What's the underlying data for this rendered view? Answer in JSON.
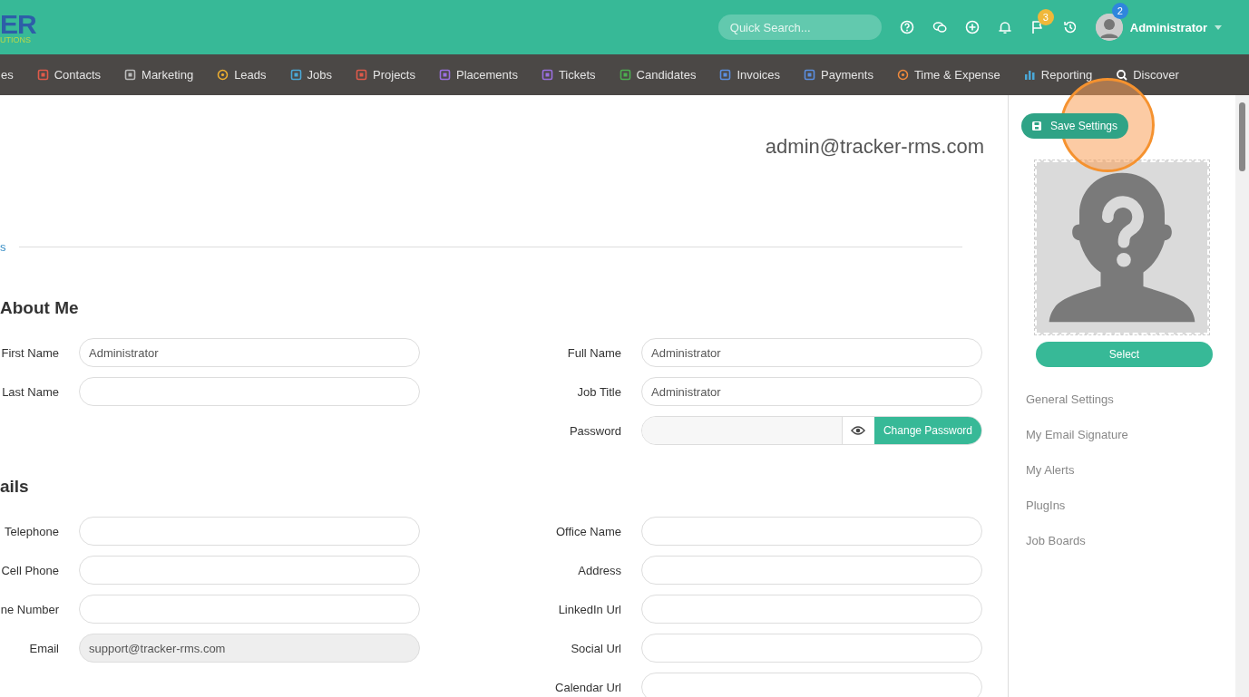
{
  "header": {
    "logo_text": "ER",
    "logo_subtext": "UTIONS",
    "search": {
      "placeholder": "Quick Search..."
    },
    "flag_badge": "3",
    "avatar_badge": "2",
    "user_name": "Administrator"
  },
  "nav": {
    "items": [
      {
        "label": "es"
      },
      {
        "label": "Contacts"
      },
      {
        "label": "Marketing"
      },
      {
        "label": "Leads"
      },
      {
        "label": "Jobs"
      },
      {
        "label": "Projects"
      },
      {
        "label": "Placements"
      },
      {
        "label": "Tickets"
      },
      {
        "label": "Candidates"
      },
      {
        "label": "Invoices"
      },
      {
        "label": "Payments"
      },
      {
        "label": "Time & Expense"
      },
      {
        "label": "Reporting"
      },
      {
        "label": "Discover"
      }
    ]
  },
  "main": {
    "account_email": "admin@tracker-rms.com",
    "tab_link": "s",
    "sections": [
      {
        "title": "About Me",
        "rows": [
          {
            "left": {
              "label": "First Name",
              "value": "Administrator"
            },
            "right": {
              "label": "Full Name",
              "value": "Administrator",
              "kind": "text"
            }
          },
          {
            "left": {
              "label": "Last Name"
            },
            "right": {
              "label": "Job Title",
              "value": "Administrator",
              "kind": "text"
            }
          },
          {
            "right": {
              "label": "Password",
              "kind": "password",
              "button": "Change Password"
            }
          }
        ]
      },
      {
        "title": "ails",
        "rows": [
          {
            "left": {
              "label": "Telephone"
            },
            "right": {
              "label": "Office Name",
              "kind": "text"
            }
          },
          {
            "left": {
              "label": "Cell Phone"
            },
            "right": {
              "label": "Address",
              "kind": "text"
            }
          },
          {
            "left": {
              "label": "ne Number"
            },
            "right": {
              "label": "LinkedIn Url",
              "kind": "text"
            }
          },
          {
            "left": {
              "label": "Email",
              "value": "support@tracker-rms.com",
              "readonly": true
            },
            "right": {
              "label": "Social Url",
              "kind": "text"
            }
          },
          {
            "right": {
              "label": "Calendar Url",
              "kind": "text"
            }
          }
        ]
      }
    ]
  },
  "sidebar": {
    "save_button": "Save Settings",
    "select_button": "Select",
    "menu": [
      {
        "label": "General Settings"
      },
      {
        "label": "My Email Signature"
      },
      {
        "label": "My Alerts"
      },
      {
        "label": "PlugIns"
      },
      {
        "label": "Job Boards"
      }
    ]
  }
}
